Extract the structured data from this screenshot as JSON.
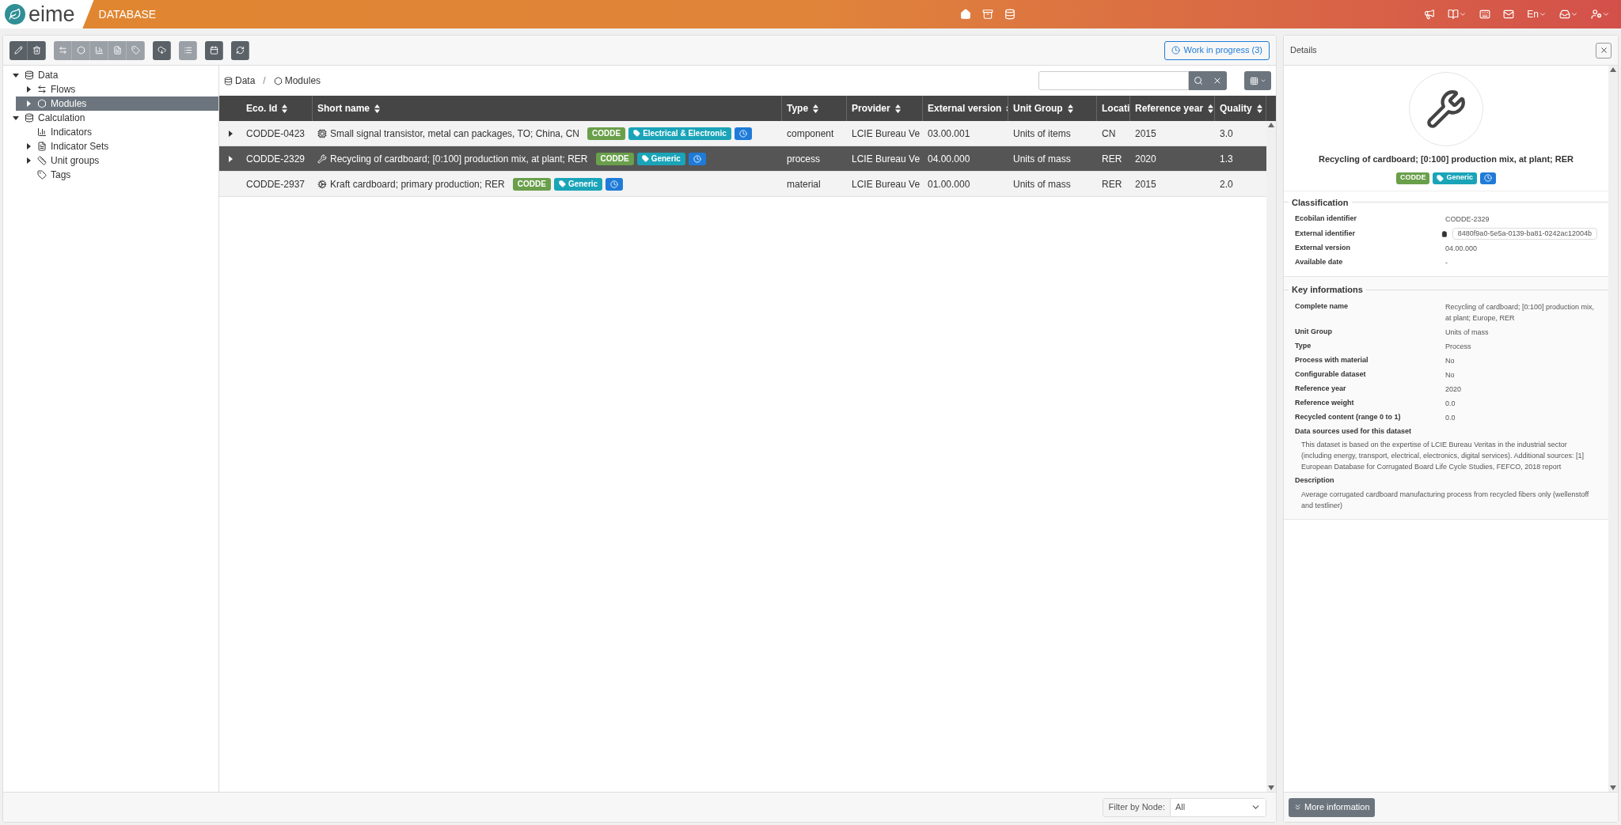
{
  "header": {
    "logo": "eime",
    "section": "DATABASE",
    "language": "En"
  },
  "toolbar": {
    "groups": [
      {
        "disabled": false,
        "buttons": [
          {
            "kind": "edit"
          },
          {
            "kind": "delete"
          }
        ]
      },
      {
        "disabled": true,
        "buttons": [
          {
            "kind": "flows"
          },
          {
            "kind": "modules"
          },
          {
            "kind": "indicators"
          },
          {
            "kind": "indicator-sets"
          },
          {
            "kind": "tags"
          }
        ]
      },
      {
        "disabled": false,
        "buttons": [
          {
            "kind": "cloud"
          }
        ]
      },
      {
        "disabled": true,
        "buttons": [
          {
            "kind": "list"
          }
        ]
      },
      {
        "disabled": false,
        "buttons": [
          {
            "kind": "calendar"
          }
        ]
      },
      {
        "disabled": false,
        "buttons": [
          {
            "kind": "refresh"
          }
        ]
      }
    ],
    "work_in_progress": "Work in progress (3)"
  },
  "tree": [
    {
      "label": "Data",
      "kind": "database",
      "expanded": true,
      "selected": false,
      "children": [
        {
          "label": "Flows",
          "kind": "flows",
          "expanded": false,
          "selected": false,
          "has_children": true
        },
        {
          "label": "Modules",
          "kind": "modules",
          "expanded": false,
          "selected": true,
          "has_children": true
        }
      ]
    },
    {
      "label": "Calculation",
      "kind": "database",
      "expanded": true,
      "selected": false,
      "children": [
        {
          "label": "Indicators",
          "kind": "indicators",
          "expanded": false,
          "selected": false,
          "has_children": false
        },
        {
          "label": "Indicator Sets",
          "kind": "indicator-sets",
          "expanded": false,
          "selected": false,
          "has_children": true
        },
        {
          "label": "Unit groups",
          "kind": "units",
          "expanded": false,
          "selected": false,
          "has_children": true
        },
        {
          "label": "Tags",
          "kind": "tags",
          "expanded": false,
          "selected": false,
          "has_children": false
        }
      ]
    }
  ],
  "breadcrumb": {
    "separator": "/",
    "items": [
      {
        "label": "Data",
        "kind": "database"
      },
      {
        "label": "Modules",
        "kind": "modules"
      }
    ]
  },
  "table": {
    "columns": [
      "Eco. Id",
      "Short name",
      "Type",
      "Provider",
      "External version",
      "Unit Group",
      "Locati",
      "Reference year",
      "Quality"
    ],
    "rows": [
      {
        "selected": false,
        "expandable": true,
        "eco_id": "CODDE-0423",
        "short_name": "Small signal transistor, metal can packages, TO; China, CN",
        "tags": [
          {
            "kind": "source",
            "label": "CODDE"
          },
          {
            "kind": "category",
            "label": "Electrical & Electronic"
          },
          {
            "kind": "status"
          }
        ],
        "type": "component",
        "provider": "LCIE Bureau Ve",
        "external_version": "03.00.001",
        "unit_group": "Units of items",
        "location": "CN",
        "reference_year": "2015",
        "quality": "3.0"
      },
      {
        "selected": true,
        "expandable": true,
        "eco_id": "CODDE-2329",
        "short_name": "Recycling of cardboard; [0:100] production mix, at plant; RER",
        "tags": [
          {
            "kind": "source",
            "label": "CODDE"
          },
          {
            "kind": "category",
            "label": "Generic"
          },
          {
            "kind": "status"
          }
        ],
        "type": "process",
        "provider": "LCIE Bureau Ve",
        "external_version": "04.00.000",
        "unit_group": "Units of mass",
        "location": "RER",
        "reference_year": "2020",
        "quality": "1.3"
      },
      {
        "selected": false,
        "expandable": false,
        "eco_id": "CODDE-2937",
        "short_name": "Kraft cardboard; primary production; RER",
        "tags": [
          {
            "kind": "source",
            "label": "CODDE"
          },
          {
            "kind": "category",
            "label": "Generic"
          },
          {
            "kind": "status"
          }
        ],
        "type": "material",
        "provider": "LCIE Bureau Ve",
        "external_version": "01.00.000",
        "unit_group": "Units of mass",
        "location": "RER",
        "reference_year": "2015",
        "quality": "2.0"
      }
    ]
  },
  "filter": {
    "label": "Filter by Node:",
    "value": "All"
  },
  "details": {
    "title": "Details",
    "name": "Recycling of cardboard; [0:100] production mix, at plant; RER",
    "tags": [
      {
        "kind": "source",
        "label": "CODDE"
      },
      {
        "kind": "category",
        "label": "Generic"
      },
      {
        "kind": "status"
      }
    ],
    "sections": [
      {
        "title": "Classification",
        "fields": [
          {
            "kind": "row",
            "label": "Ecobilan identifier",
            "value": "CODDE-2329"
          },
          {
            "kind": "copy",
            "label": "External identifier",
            "value": "8480f9a0-5e5a-0139-ba81-0242ac12004b"
          },
          {
            "kind": "row",
            "label": "External version",
            "value": "04.00.000"
          },
          {
            "kind": "row",
            "label": "Available date",
            "value": "-"
          }
        ]
      },
      {
        "title": "Key informations",
        "fields": [
          {
            "kind": "row",
            "label": "Complete name",
            "value": "Recycling of cardboard; [0:100] production mix, at plant; Europe, RER"
          },
          {
            "kind": "row",
            "label": "Unit Group",
            "value": "Units of mass"
          },
          {
            "kind": "row",
            "label": "Type",
            "value": "Process"
          },
          {
            "kind": "row",
            "label": "Process with material",
            "value": "No"
          },
          {
            "kind": "row",
            "label": "Configurable dataset",
            "value": "No"
          },
          {
            "kind": "row",
            "label": "Reference year",
            "value": "2020"
          },
          {
            "kind": "row",
            "label": "Reference weight",
            "value": "0.0"
          },
          {
            "kind": "row",
            "label": "Recycled content (range 0 to 1)",
            "value": "0.0"
          },
          {
            "kind": "block",
            "label": "Data sources used for this dataset",
            "value": "This dataset is based on the expertise of LCIE Bureau Veritas in the industrial sector (including energy, transport, electrical, electronics, digital services). Additional sources: [1] European Database for Corrugated Board Life Cycle Studies, FEFCO, 2018 report"
          },
          {
            "kind": "block",
            "label": "Description",
            "value": "Average corrugated cardboard manufacturing process from recycled fibers only (wellenstoff and testliner)"
          }
        ]
      }
    ],
    "more_button": "More information"
  }
}
